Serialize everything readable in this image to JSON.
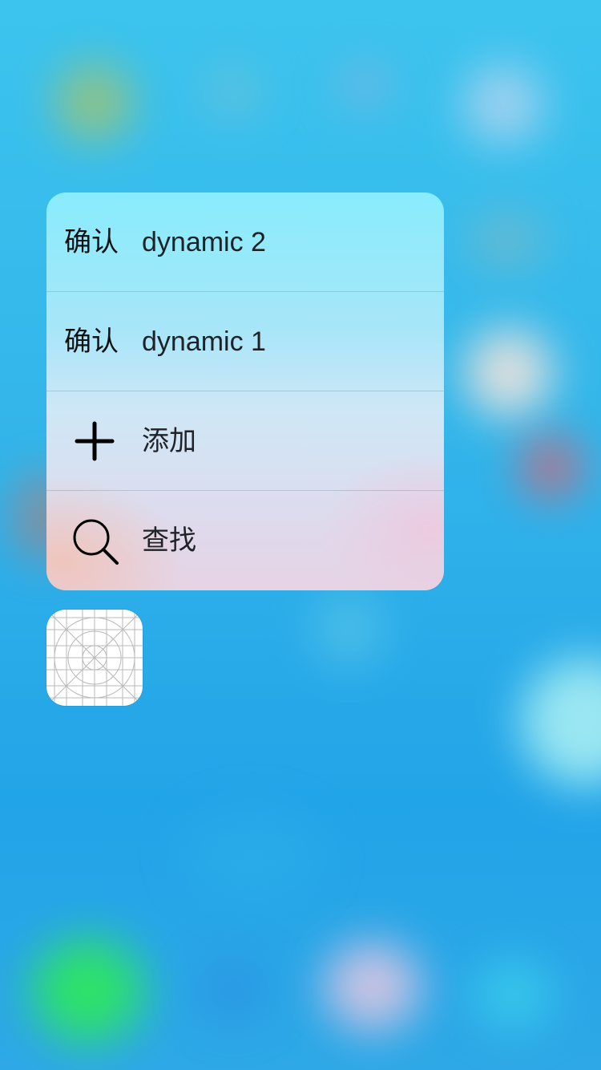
{
  "quick_actions": [
    {
      "icon_text": "确认",
      "label": "dynamic 2"
    },
    {
      "icon_text": "确认",
      "label": "dynamic 1"
    },
    {
      "icon": "plus-icon",
      "label": "添加"
    },
    {
      "icon": "search-icon",
      "label": "查找"
    }
  ],
  "app_icon": {
    "icon": "app-icon-template-grid"
  },
  "colors": {
    "background_top": "#3cc4ee",
    "background_bottom": "#22a4e8",
    "menu_top": "#88ecfc",
    "menu_bottom": "#e6d3e4",
    "label_text": "#1f2327"
  }
}
